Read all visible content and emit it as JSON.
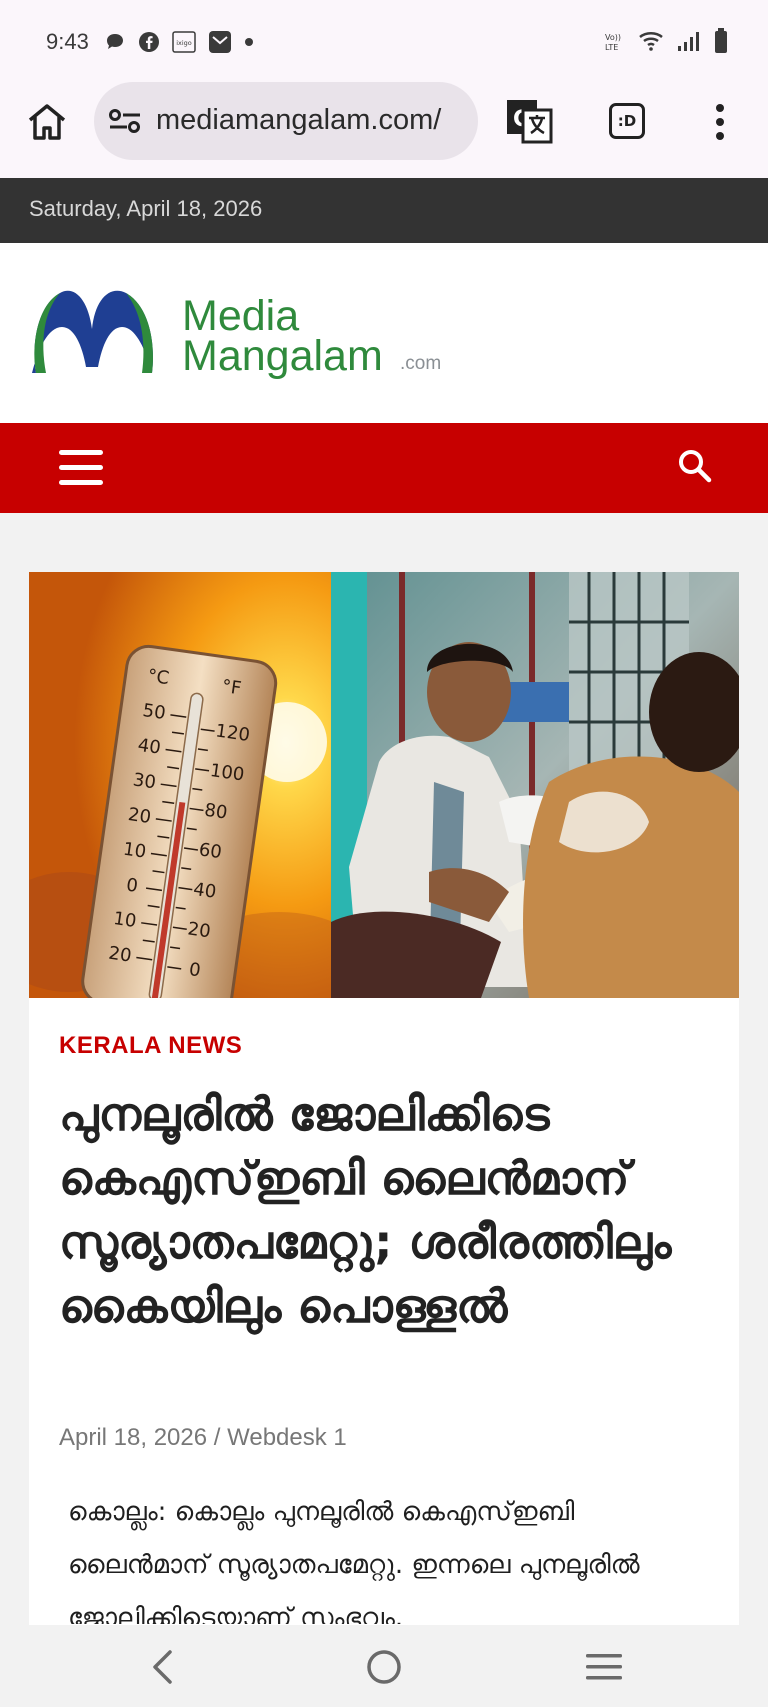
{
  "status_bar": {
    "time": "9:43",
    "left_icons": [
      "chat-bubble-icon",
      "facebook-icon",
      "ixigo-icon",
      "mail-icon",
      "dot-icon"
    ],
    "right_icons": [
      "volte-icon",
      "wifi-icon",
      "signal-icon",
      "battery-icon"
    ],
    "lte_label": "Vo)) LTE",
    "ixigo_label": "ixigo"
  },
  "browser": {
    "url": "mediamangalam.com/",
    "home_icon": "home-icon",
    "site_settings_icon": "tune-icon",
    "translate_icon": "translate-icon",
    "tab_icon": "tab-switcher-icon",
    "tab_label": ":D",
    "menu_icon": "more-vert-icon"
  },
  "date_bar": {
    "date": "Saturday, April 18, 2026"
  },
  "logo": {
    "line1": "Media",
    "line2": "Mangalam",
    "suffix": ".com"
  },
  "nav": {
    "menu_icon": "hamburger-icon",
    "search_icon": "search-icon"
  },
  "hero_image": {
    "thermometer_celsius": [
      "°C",
      "50",
      "40",
      "30",
      "20",
      "10",
      "0",
      "10",
      "20"
    ],
    "thermometer_fahrenheit": [
      "°F",
      "120",
      "100",
      "80",
      "60",
      "40",
      "20",
      "0"
    ]
  },
  "article": {
    "category": "KERALA NEWS",
    "headline": "പുനലൂരിൽ ജോലിക്കിടെ കെഎസ്ഇബി ലൈൻമാന് സൂര്യാതപമേറ്റു; ശരീരത്തിലും കൈയിലും പൊള്ളൽ",
    "date": "April 18, 2026",
    "separator": "/",
    "author": "Webdesk 1",
    "body": "കൊല്ലം: കൊല്ലം പുനലൂരിൽ കെഎസ്ഇബി ലൈൻമാന് സൂര്യാതപമേറ്റു. ഇന്നലെ പുനലൂരിൽ ജോലിക്കിടെയാണ് സംഭവം."
  },
  "colors": {
    "brand_red": "#c70000",
    "brand_green": "#2f8a3c",
    "brand_blue": "#1f3f93",
    "date_bar_bg": "#333333"
  },
  "system_nav": {
    "back_icon": "back-chevron-icon",
    "home_icon": "home-circle-icon",
    "recents_icon": "recents-icon"
  }
}
